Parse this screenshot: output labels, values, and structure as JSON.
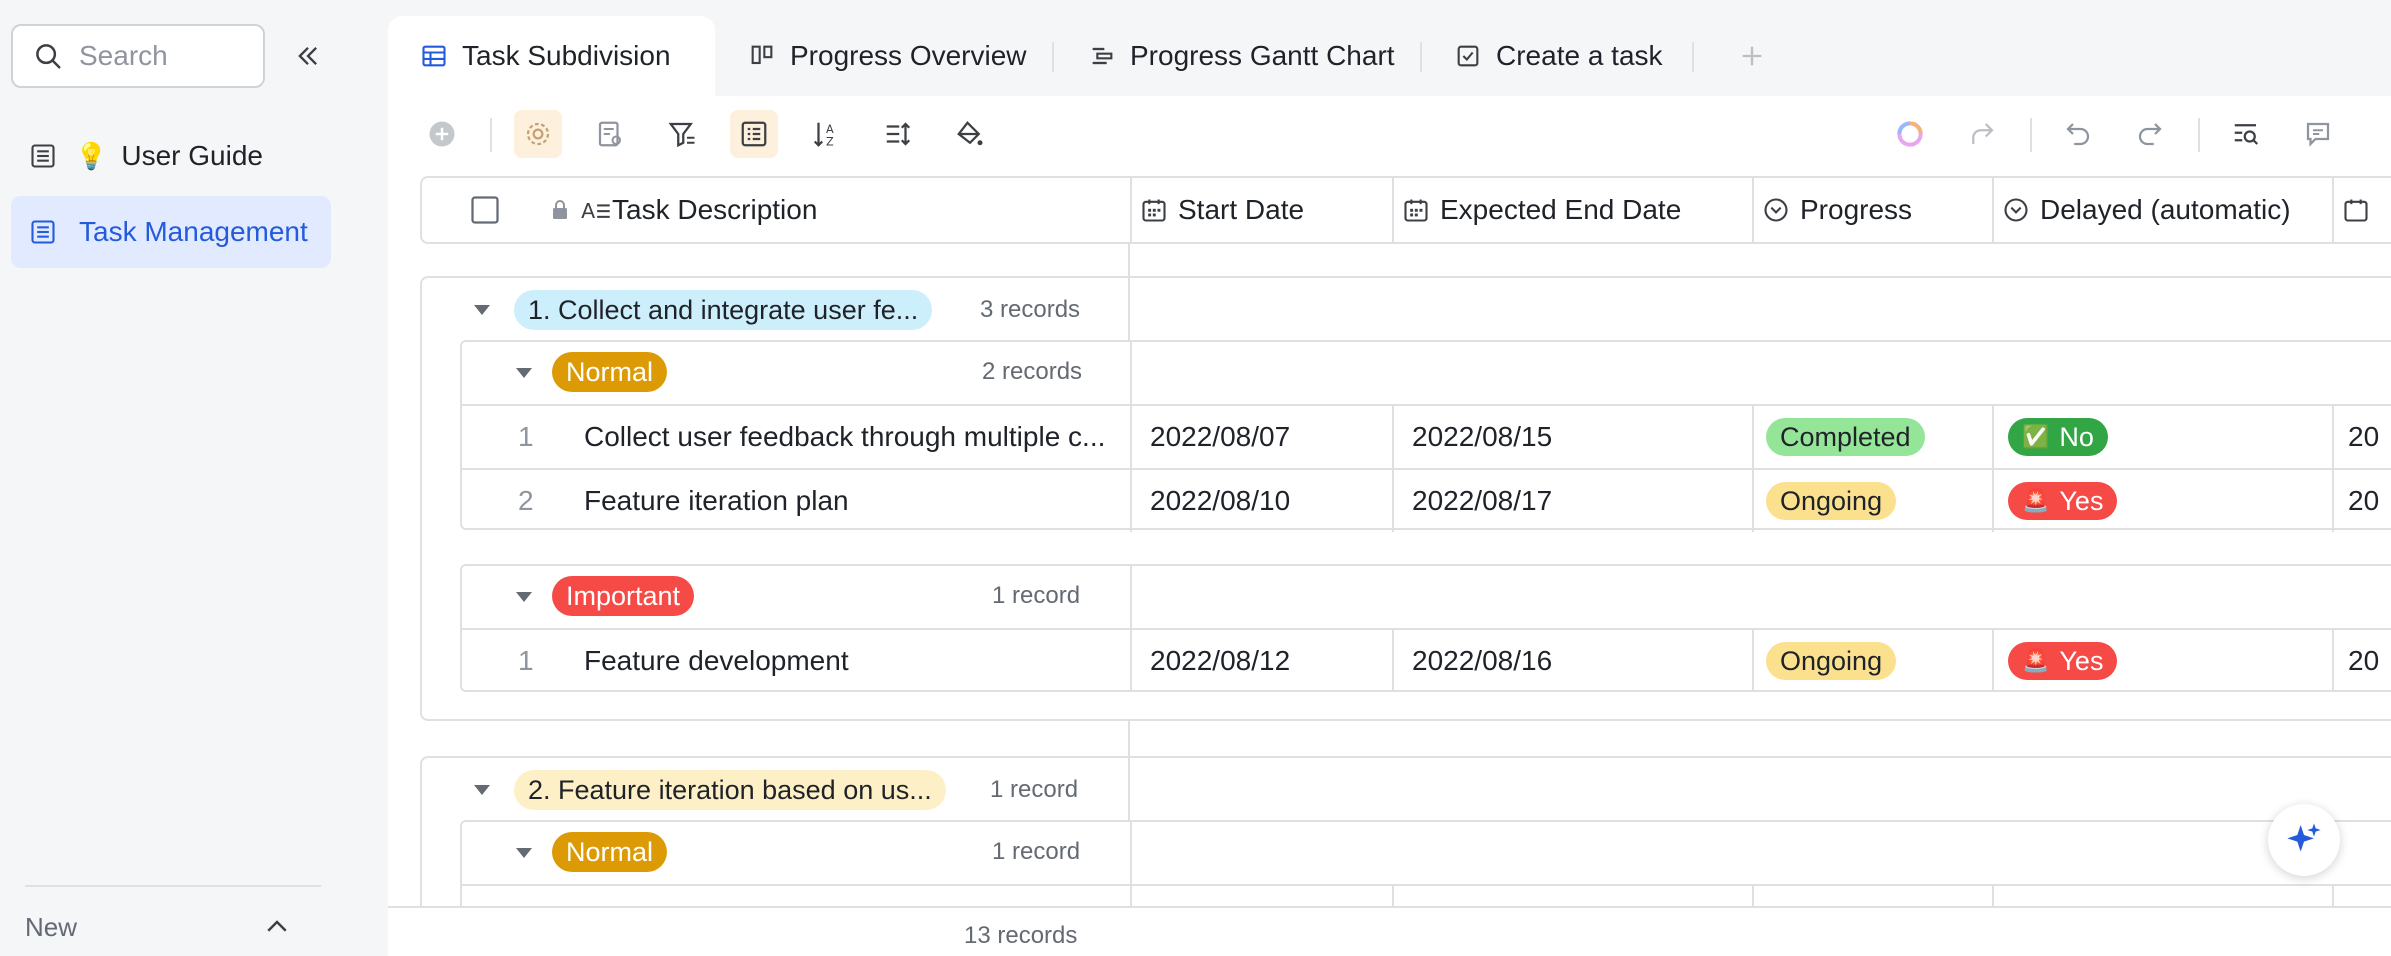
{
  "sidebar": {
    "search_placeholder": "Search",
    "items": [
      {
        "emoji": "💡",
        "label": "User Guide"
      },
      {
        "label": "Task Management"
      }
    ],
    "new_label": "New"
  },
  "tabs": [
    {
      "label": "Task Subdivision",
      "icon": "grid-table-icon"
    },
    {
      "label": "Progress Overview",
      "icon": "kanban-icon"
    },
    {
      "label": "Progress Gantt Chart",
      "icon": "gantt-icon"
    },
    {
      "label": "Create a task",
      "icon": "form-checkbox-icon"
    }
  ],
  "columns": [
    {
      "label": "Task Description",
      "icon": "text-field-icon"
    },
    {
      "label": "Start Date",
      "icon": "calendar-icon"
    },
    {
      "label": "Expected End Date",
      "icon": "calendar-icon"
    },
    {
      "label": "Progress",
      "icon": "single-select-icon"
    },
    {
      "label": "Delayed (automatic)",
      "icon": "single-select-icon"
    }
  ],
  "groups": [
    {
      "label": "1. Collect and integrate user fe...",
      "count": "3 records",
      "color": "#cdeefb",
      "subgroups": [
        {
          "label": "Normal",
          "count": "2 records",
          "color": "#dc9b04",
          "rows": [
            {
              "num": "1",
              "desc": "Collect user feedback through multiple c...",
              "start": "2022/08/07",
              "end": "2022/08/15",
              "progress": "Completed",
              "delayed": "No",
              "next": "20"
            },
            {
              "num": "2",
              "desc": "Feature iteration plan",
              "start": "2022/08/10",
              "end": "2022/08/17",
              "progress": "Ongoing",
              "delayed": "Yes",
              "next": "20"
            }
          ]
        },
        {
          "label": "Important",
          "count": "1 record",
          "color": "#f54a45",
          "rows": [
            {
              "num": "1",
              "desc": "Feature development",
              "start": "2022/08/12",
              "end": "2022/08/16",
              "progress": "Ongoing",
              "delayed": "Yes",
              "next": "20"
            }
          ]
        }
      ]
    },
    {
      "label": "2. Feature iteration based on us...",
      "count": "1 record",
      "color": "#fdf0c6",
      "subgroups": [
        {
          "label": "Normal",
          "count": "1 record",
          "color": "#dc9b04"
        }
      ]
    }
  ],
  "footer": {
    "records": "13 records"
  },
  "colors": {
    "accent": "#245bdb",
    "completed": "#95e599",
    "ongoing": "#fbe08e",
    "no": "#32a645",
    "yes": "#f54a45"
  }
}
